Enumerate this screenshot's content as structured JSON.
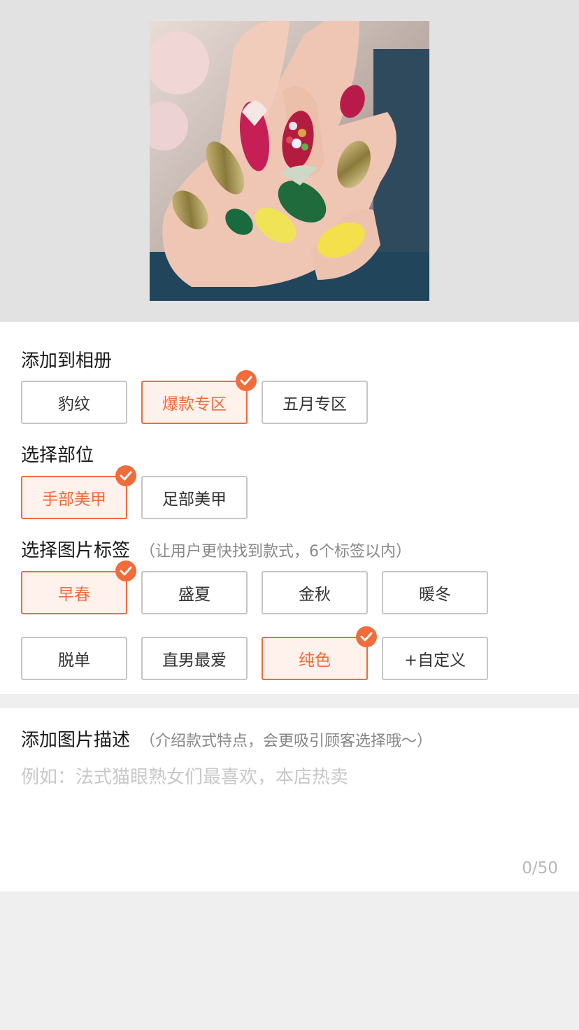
{
  "album": {
    "title": "添加到相册",
    "chips": [
      {
        "label": "豹纹",
        "selected": false
      },
      {
        "label": "爆款专区",
        "selected": true
      },
      {
        "label": "五月专区",
        "selected": false
      }
    ]
  },
  "part": {
    "title": "选择部位",
    "chips": [
      {
        "label": "手部美甲",
        "selected": true
      },
      {
        "label": "足部美甲",
        "selected": false
      }
    ]
  },
  "tags": {
    "title": "选择图片标签",
    "hint": "（让用户更快找到款式，6个标签以内）",
    "chips": [
      {
        "label": "早春",
        "selected": true
      },
      {
        "label": "盛夏",
        "selected": false
      },
      {
        "label": "金秋",
        "selected": false
      },
      {
        "label": "暖冬",
        "selected": false
      },
      {
        "label": "脱单",
        "selected": false
      },
      {
        "label": "直男最爱",
        "selected": false
      },
      {
        "label": "纯色",
        "selected": true
      },
      {
        "label": "+自定义",
        "selected": false
      }
    ]
  },
  "description": {
    "title": "添加图片描述",
    "hint": "（介绍款式特点，会更吸引顾客选择哦～）",
    "placeholder": "例如：法式猫眼熟女们最喜欢，本店热卖",
    "counter": "0/50"
  },
  "colors": {
    "accent": "#f26b3a",
    "accent_bg": "#fff1ec",
    "border": "#c6c6c6"
  }
}
